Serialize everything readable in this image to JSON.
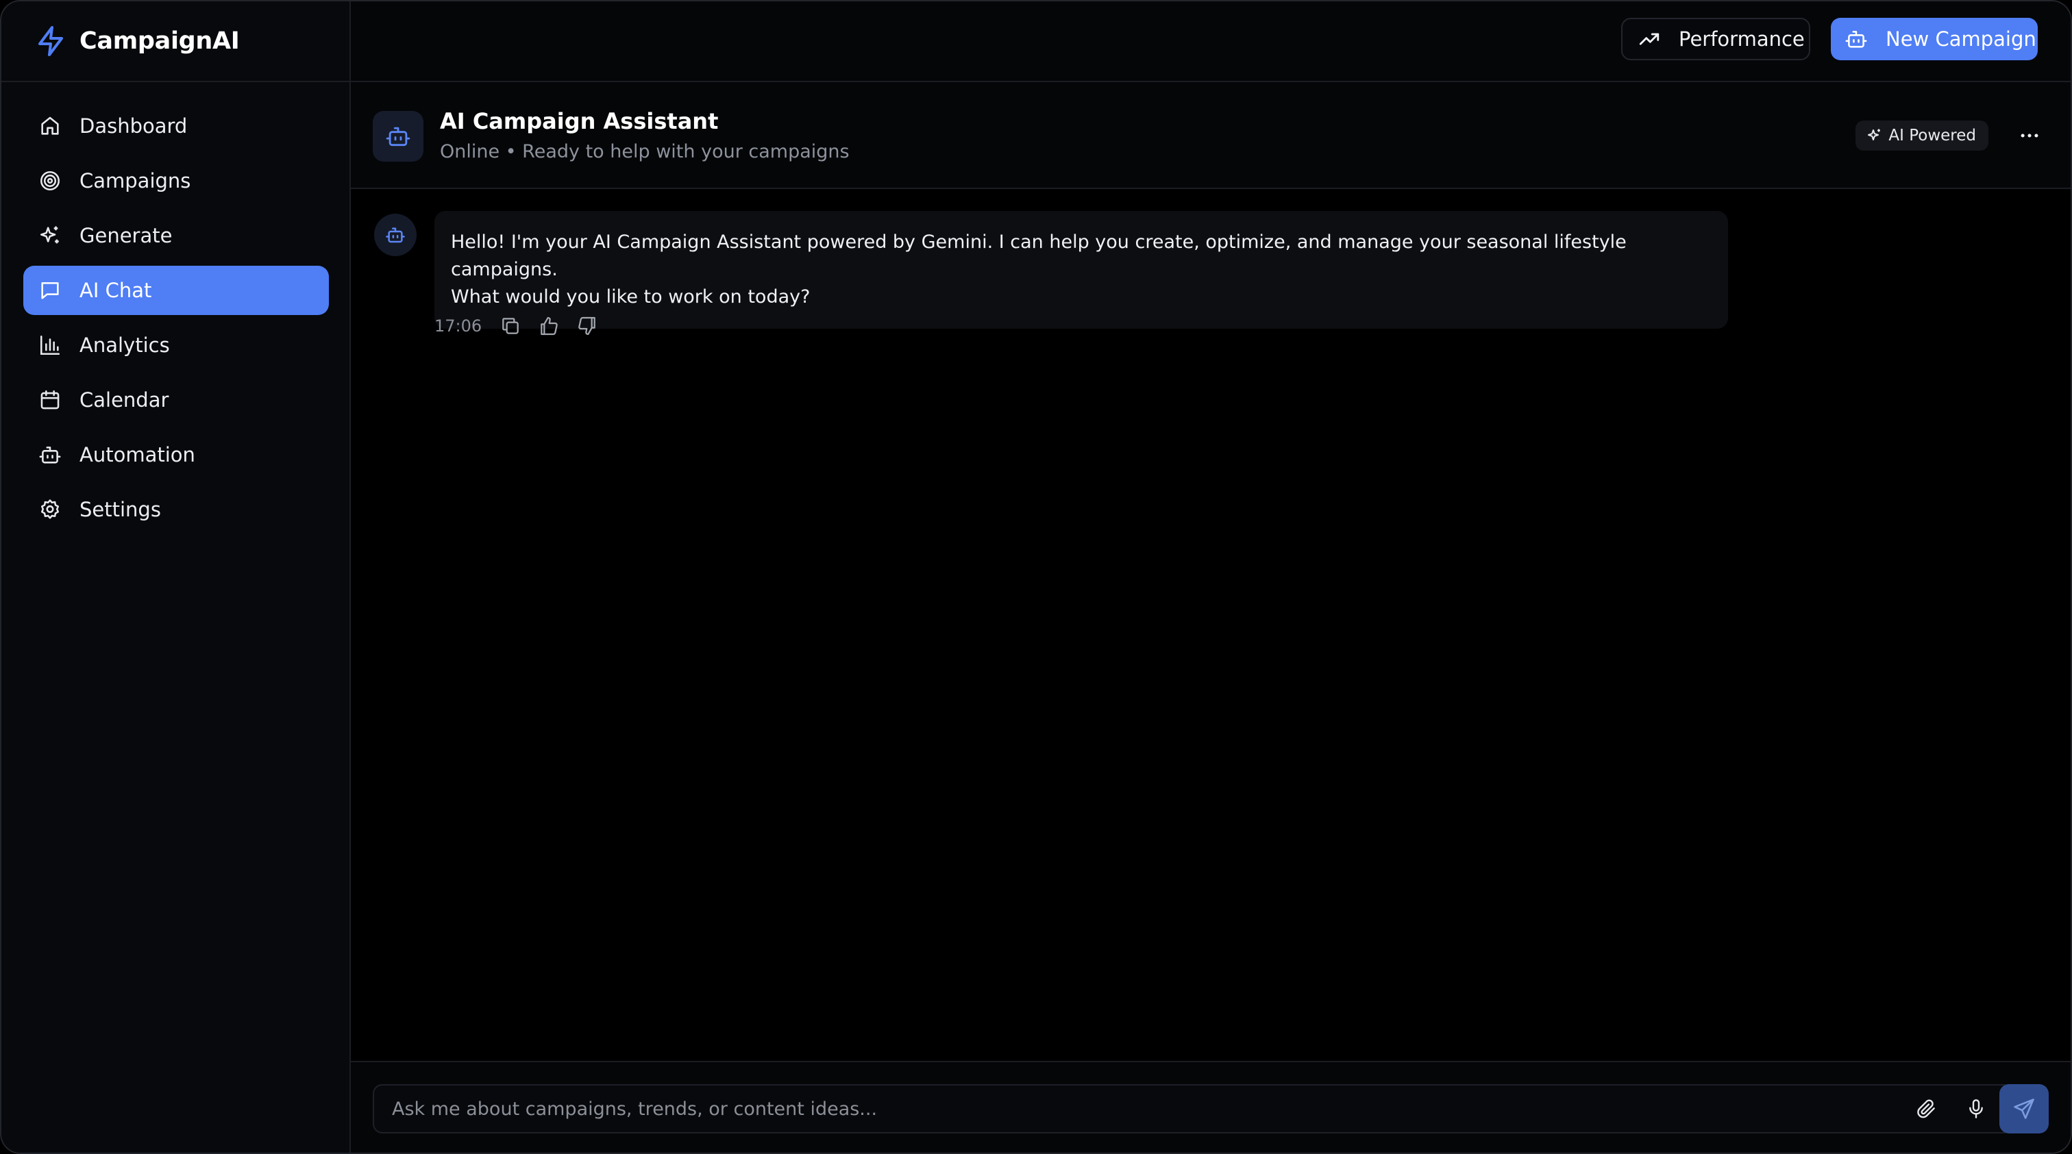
{
  "app": {
    "name": "CampaignAI",
    "accent_color": "#4f7ef5"
  },
  "sidebar": {
    "items": [
      {
        "label": "Dashboard",
        "icon": "home-icon",
        "active": false
      },
      {
        "label": "Campaigns",
        "icon": "target-icon",
        "active": false
      },
      {
        "label": "Generate",
        "icon": "sparkles-icon",
        "active": false
      },
      {
        "label": "AI Chat",
        "icon": "chat-icon",
        "active": true
      },
      {
        "label": "Analytics",
        "icon": "bar-chart-icon",
        "active": false
      },
      {
        "label": "Calendar",
        "icon": "calendar-icon",
        "active": false
      },
      {
        "label": "Automation",
        "icon": "bot-icon",
        "active": false
      },
      {
        "label": "Settings",
        "icon": "gear-icon",
        "active": false
      }
    ]
  },
  "topbar": {
    "performance_label": "Performance",
    "new_campaign_label": "New Campaign"
  },
  "chat": {
    "title": "AI Campaign Assistant",
    "status": "Online • Ready to help with your campaigns",
    "badge": "AI Powered"
  },
  "messages": [
    {
      "sender": "assistant",
      "text_line1": "Hello! I'm your AI Campaign Assistant powered by Gemini. I can help you create, optimize, and manage your seasonal lifestyle campaigns.",
      "text_line2": "What would you like to work on today?",
      "time": "17:06"
    }
  ],
  "input": {
    "placeholder": "Ask me about campaigns, trends, or content ideas...",
    "value": ""
  }
}
